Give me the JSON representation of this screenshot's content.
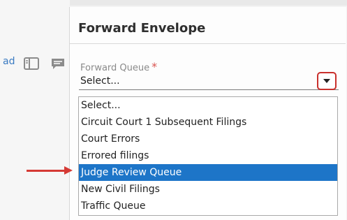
{
  "background": {
    "link_fragment": "ad"
  },
  "dialog": {
    "title": "Forward Envelope",
    "field": {
      "label": "Forward Queue",
      "required_marker": "*",
      "selected_value": "Select..."
    },
    "dropdown": {
      "options": [
        "Select...",
        "Circuit Court 1 Subsequent Filings",
        "Court Errors",
        "Errored filings",
        "Judge Review Queue",
        "New Civil Filings",
        "Traffic Queue"
      ],
      "highlighted": "Judge Review Queue"
    }
  },
  "colors": {
    "highlight": "#1d75c8",
    "annotation_red": "#d53a35",
    "required_red": "#d9534f"
  },
  "icons": [
    "panel-icon",
    "comment-icon",
    "chevron-down-icon",
    "arrow-right-icon"
  ]
}
